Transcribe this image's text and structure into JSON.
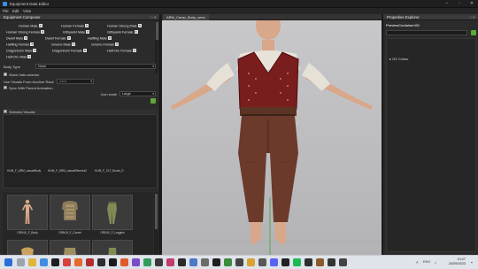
{
  "window": {
    "title": "Equipment Data Editor"
  },
  "menu": [
    "File",
    "Edit",
    "View"
  ],
  "left": {
    "title": "Equipment Composer",
    "races": [
      {
        "label": "Human Male"
      },
      {
        "label": "Human Female"
      },
      {
        "label": "Human Strong Male"
      },
      {
        "label": "Human Strong Female"
      },
      {
        "label": "Githyanki Male"
      },
      {
        "label": "Githyanki Female"
      },
      {
        "label": "Dwarf Male"
      },
      {
        "label": "Dwarf Female"
      },
      {
        "label": "Halfling Male"
      },
      {
        "label": "Halfling Female"
      },
      {
        "label": "Gnome Male"
      },
      {
        "label": "Gnome Female"
      },
      {
        "label": "Dragonborn Male"
      },
      {
        "label": "Dragonborn Female"
      },
      {
        "label": "Half-Orc Female"
      },
      {
        "label": "Half-Orc Male"
      }
    ],
    "body_type_label": "Body Type",
    "body_type_value": "None",
    "show_hats": "Show Hats selector",
    "use_visuals_label": "Use Visuals From Another Race",
    "use_visuals_value": "none",
    "sync_anim": "Sync With Parent Animation",
    "icon_scale_label": "Icon scale",
    "icon_scale_value": "Large",
    "selected_visuals": "Selected Visuals",
    "visual_names": [
      "HUM_F_ARM_casualBody",
      "HUM_F_ARM_casualSleeves2",
      "HUM_F_CLT_Boots_D"
    ],
    "thumbnails": [
      {
        "label": "ORN10_F_Body"
      },
      {
        "label": "ORN10_F_Corset"
      },
      {
        "label": "ORN10_F_Leggins"
      }
    ]
  },
  "viewport": {
    "tab": "ARM_Camp_Body_wms"
  },
  "right": {
    "title": "Properties Explorer",
    "object": "PreviewContainerVM",
    "item": "OZ Colour"
  },
  "taskbar": {
    "time": "10:27",
    "date": "24/05/2023",
    "lang": "ENG"
  },
  "colors": {
    "accent_green": "#5fa83a",
    "panel_bg": "#2b2b2b",
    "viewport_bg": "#b7b7b9"
  }
}
